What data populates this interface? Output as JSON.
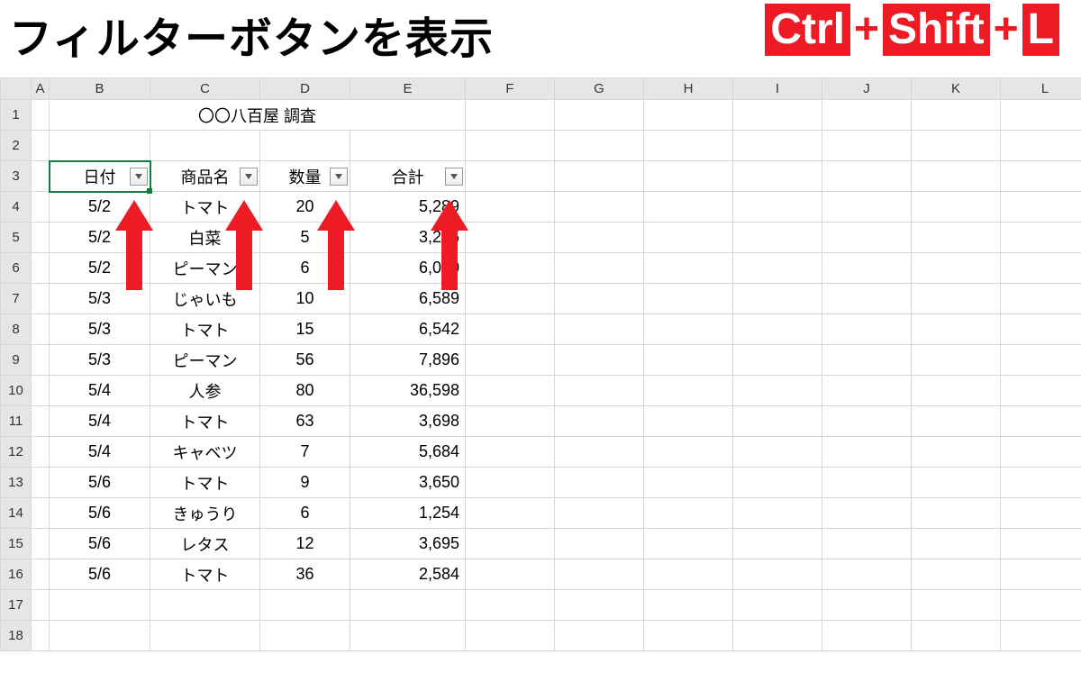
{
  "banner": {
    "title": "フィルターボタンを表示",
    "shortcut": {
      "k1": "Ctrl",
      "plus": "+",
      "k2": "Shift",
      "k3": "L"
    }
  },
  "columns": [
    "A",
    "B",
    "C",
    "D",
    "E",
    "F",
    "G",
    "H",
    "I",
    "J",
    "K",
    "L"
  ],
  "row_numbers": [
    "1",
    "2",
    "3",
    "4",
    "5",
    "6",
    "7",
    "8",
    "9",
    "10",
    "11",
    "12",
    "13",
    "14",
    "15",
    "16",
    "17",
    "18"
  ],
  "sheet_title": "〇〇八百屋 調査",
  "headers": {
    "b": "日付",
    "c": "商品名",
    "d": "数量",
    "e": "合計"
  },
  "rows": [
    {
      "b": "5/2",
      "c": "トマト",
      "d": "20",
      "e": "5,289"
    },
    {
      "b": "5/2",
      "c": "白菜",
      "d": "5",
      "e": "3,265"
    },
    {
      "b": "5/2",
      "c": "ピーマン",
      "d": "6",
      "e": "6,000"
    },
    {
      "b": "5/3",
      "c": "じゃいも",
      "d": "10",
      "e": "6,589"
    },
    {
      "b": "5/3",
      "c": "トマト",
      "d": "15",
      "e": "6,542"
    },
    {
      "b": "5/3",
      "c": "ピーマン",
      "d": "56",
      "e": "7,896"
    },
    {
      "b": "5/4",
      "c": "人参",
      "d": "80",
      "e": "36,598"
    },
    {
      "b": "5/4",
      "c": "トマト",
      "d": "63",
      "e": "3,698"
    },
    {
      "b": "5/4",
      "c": "キャベツ",
      "d": "7",
      "e": "5,684"
    },
    {
      "b": "5/6",
      "c": "トマト",
      "d": "9",
      "e": "3,650"
    },
    {
      "b": "5/6",
      "c": "きゅうり",
      "d": "6",
      "e": "1,254"
    },
    {
      "b": "5/6",
      "c": "レタス",
      "d": "12",
      "e": "3,695"
    },
    {
      "b": "5/6",
      "c": "トマト",
      "d": "36",
      "e": "2,584"
    }
  ],
  "annotation": {
    "arrow_color": "#ed1c24"
  }
}
